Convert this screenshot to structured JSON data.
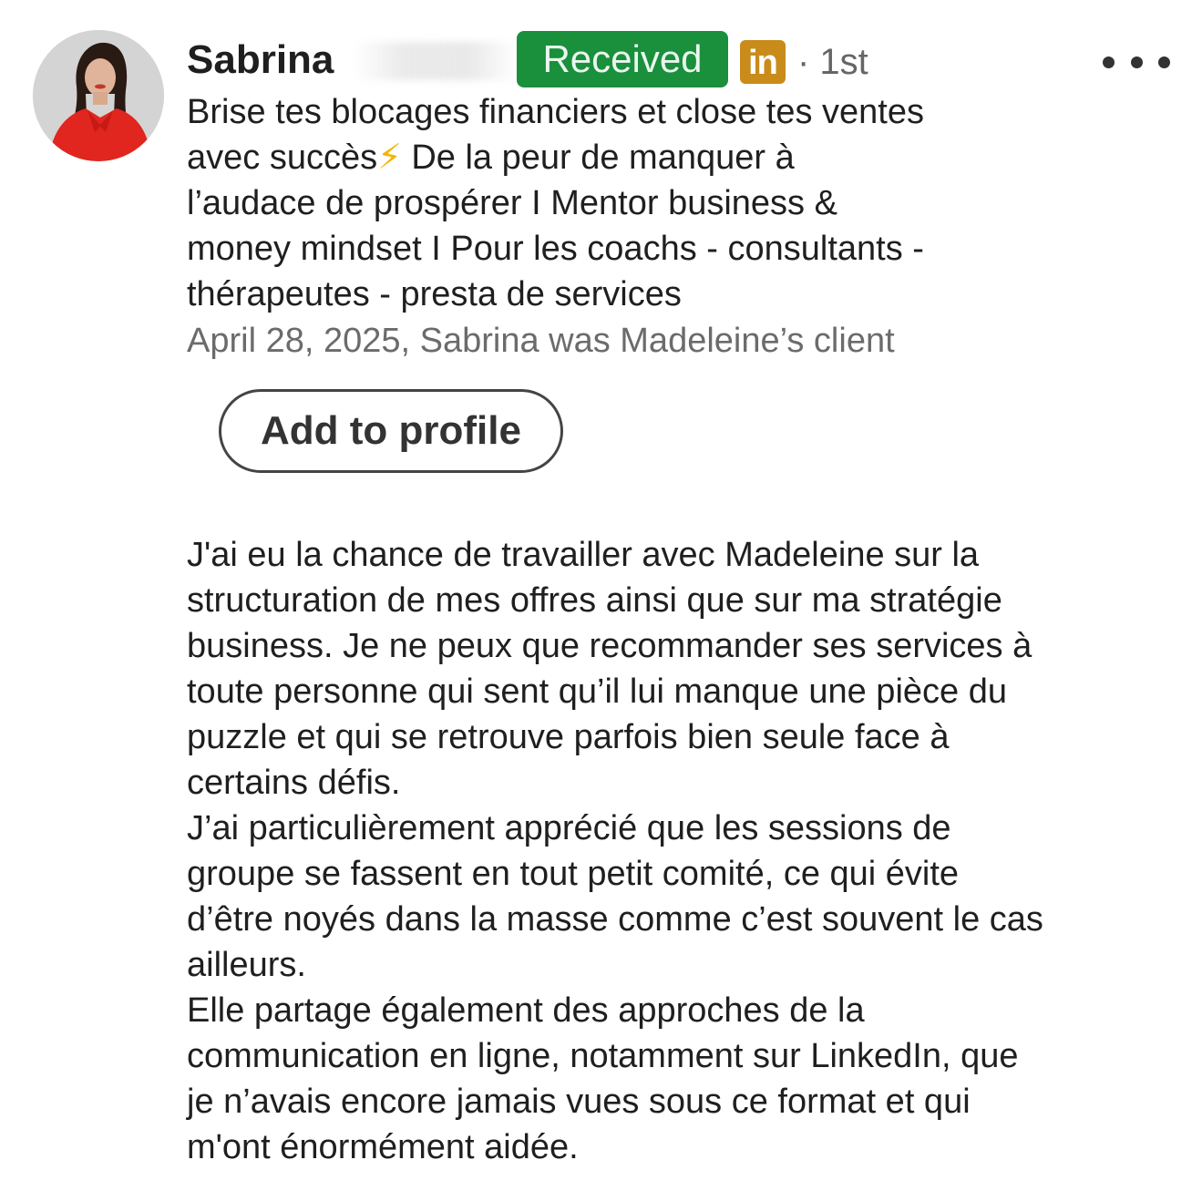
{
  "recommender": {
    "name": "Sabrina",
    "badge": "Received",
    "network_icon": "linkedin-icon",
    "network_icon_text": "in",
    "degree": "· 1st",
    "headline_lines": [
      "Brise tes blocages financiers et close tes ventes",
      "avec succès",
      "⚡",
      " De la peur de manquer à",
      "l’audace de prospérer I Mentor business &",
      "money mindset I Pour les coachs - consultants -",
      "thérapeutes - presta de services"
    ],
    "meta": "April 28, 2025, Sabrina was Madeleine’s client"
  },
  "actions": {
    "add_to_profile": "Add to profile",
    "more_icon": "more-options-icon"
  },
  "recommendation_lines": [
    "J'ai eu la chance de travailler avec Madeleine sur la",
    "structuration de mes offres ainsi que sur ma stratégie",
    "business. Je ne peux que recommander ses services à",
    "toute personne qui sent qu’il lui manque une pièce du",
    "puzzle et qui se retrouve parfois bien seule face à",
    "certains défis.",
    "J’ai particulièrement apprécié que les sessions de",
    "groupe se fassent en tout petit comité, ce qui évite",
    "d’être noyés dans la masse comme c’est souvent le cas",
    "ailleurs.",
    "Elle partage également des approches de la",
    "communication en ligne, notamment sur LinkedIn, que",
    "je n’avais encore jamais vues sous ce format et qui",
    "m'ont énormément aidée."
  ],
  "colors": {
    "badge_green": "#1a8f3c",
    "linkedin_gold": "#c98b1a",
    "text": "#1f1f1f",
    "muted": "#6b6b6b"
  }
}
